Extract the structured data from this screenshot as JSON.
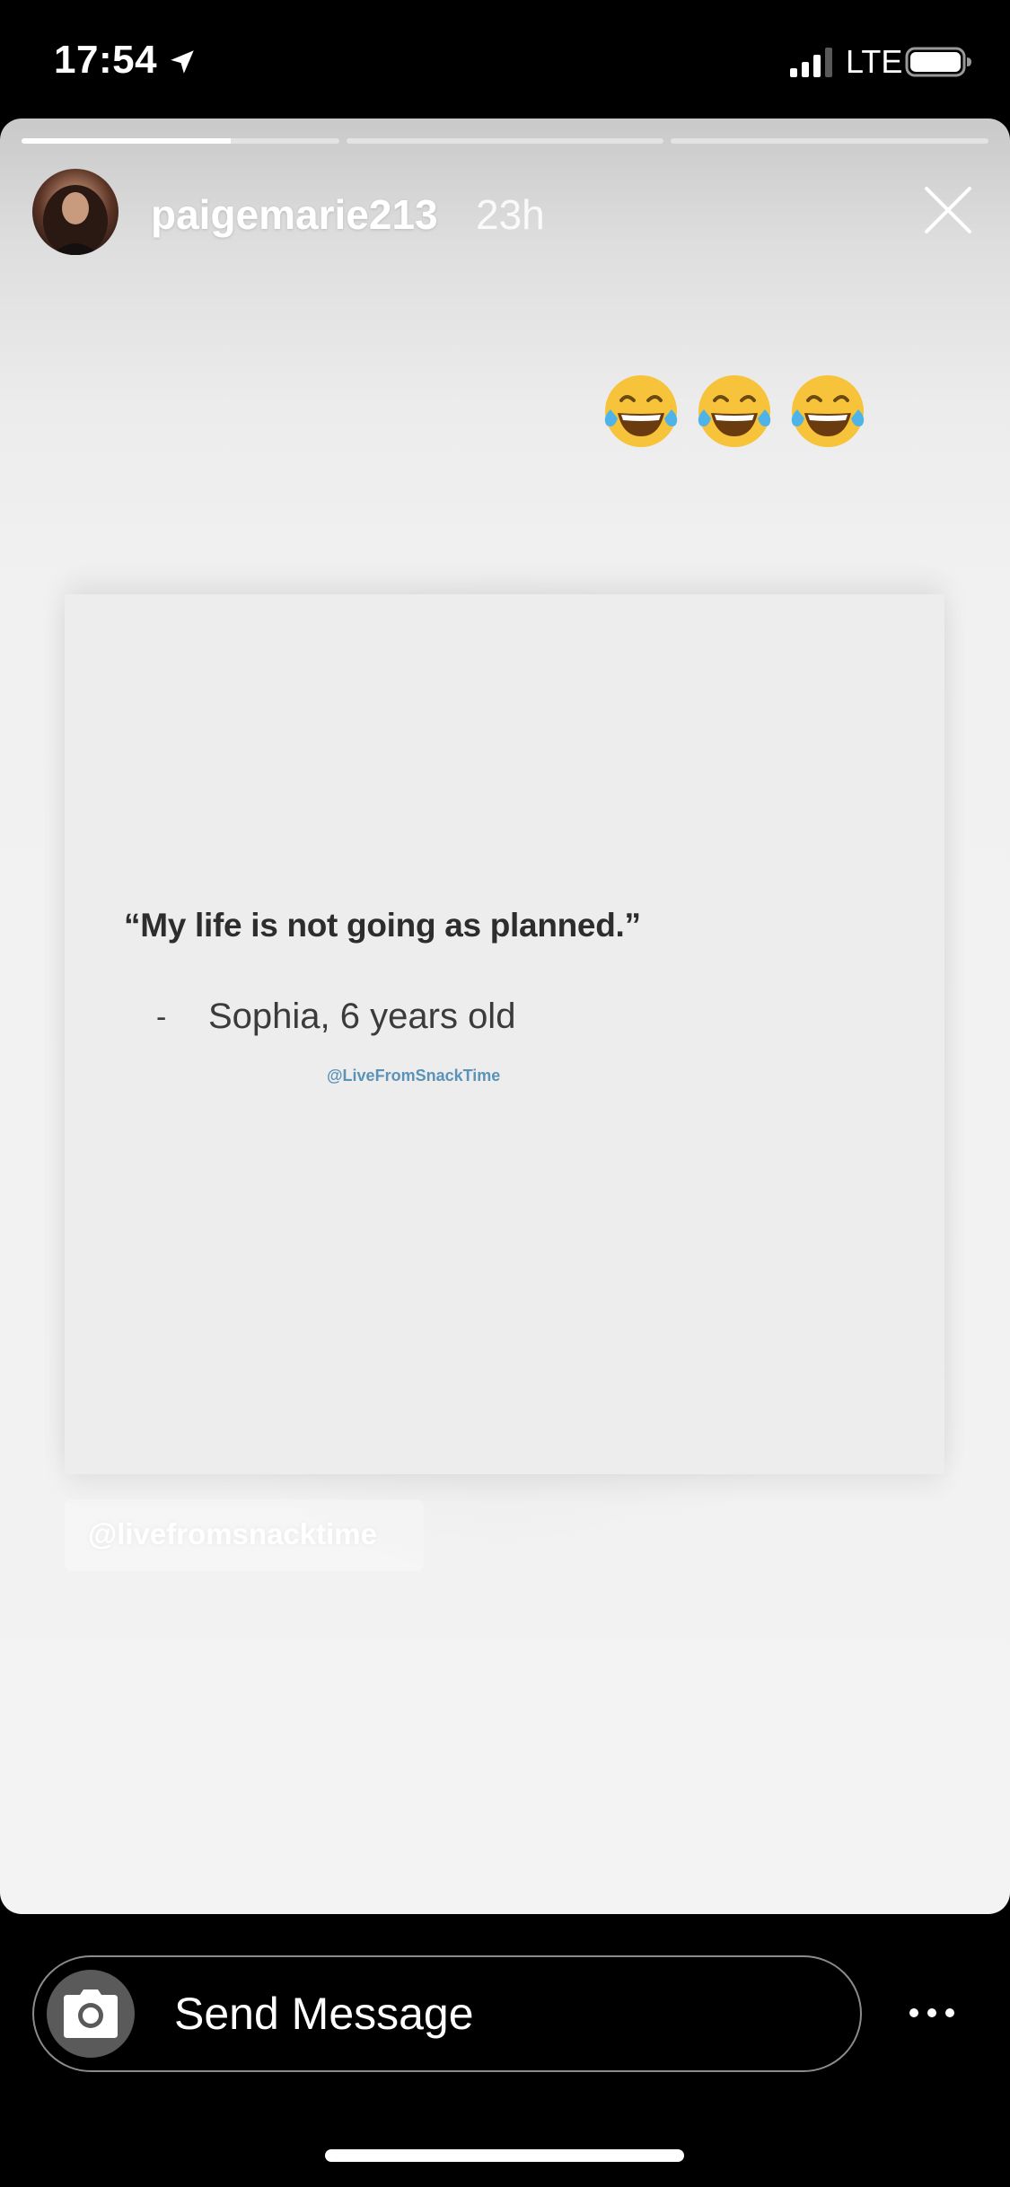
{
  "status_bar": {
    "time": "17:54",
    "network": "LTE",
    "location_icon": "location-arrow-icon",
    "signal_icon": "signal-bars-icon",
    "battery_icon": "battery-icon"
  },
  "story": {
    "progress_segments": [
      {
        "fill": 0.66
      },
      {
        "fill": 0
      },
      {
        "fill": 0
      }
    ],
    "username": "paigemarie213",
    "timestamp": "23h",
    "close_icon": "close-icon",
    "emojis": [
      "face-with-tears-of-joy",
      "face-with-tears-of-joy",
      "face-with-tears-of-joy"
    ],
    "post": {
      "quote": "“My life is not going as planned.”",
      "attribution_dash": "-",
      "attribution": "Sophia, 6 years old",
      "watermark": "@LiveFromSnackTime"
    },
    "source_tag": "@livefromsnacktime"
  },
  "bottom_bar": {
    "message_placeholder": "Send Message",
    "camera_icon": "camera-icon",
    "more_icon": "more-horizontal-icon"
  },
  "colors": {
    "background": "#000000",
    "story_background": "#f3f3f3",
    "quote_text": "#2d2d2d",
    "watermark": "#5b93b8",
    "input_border": "#8b8b8b"
  }
}
